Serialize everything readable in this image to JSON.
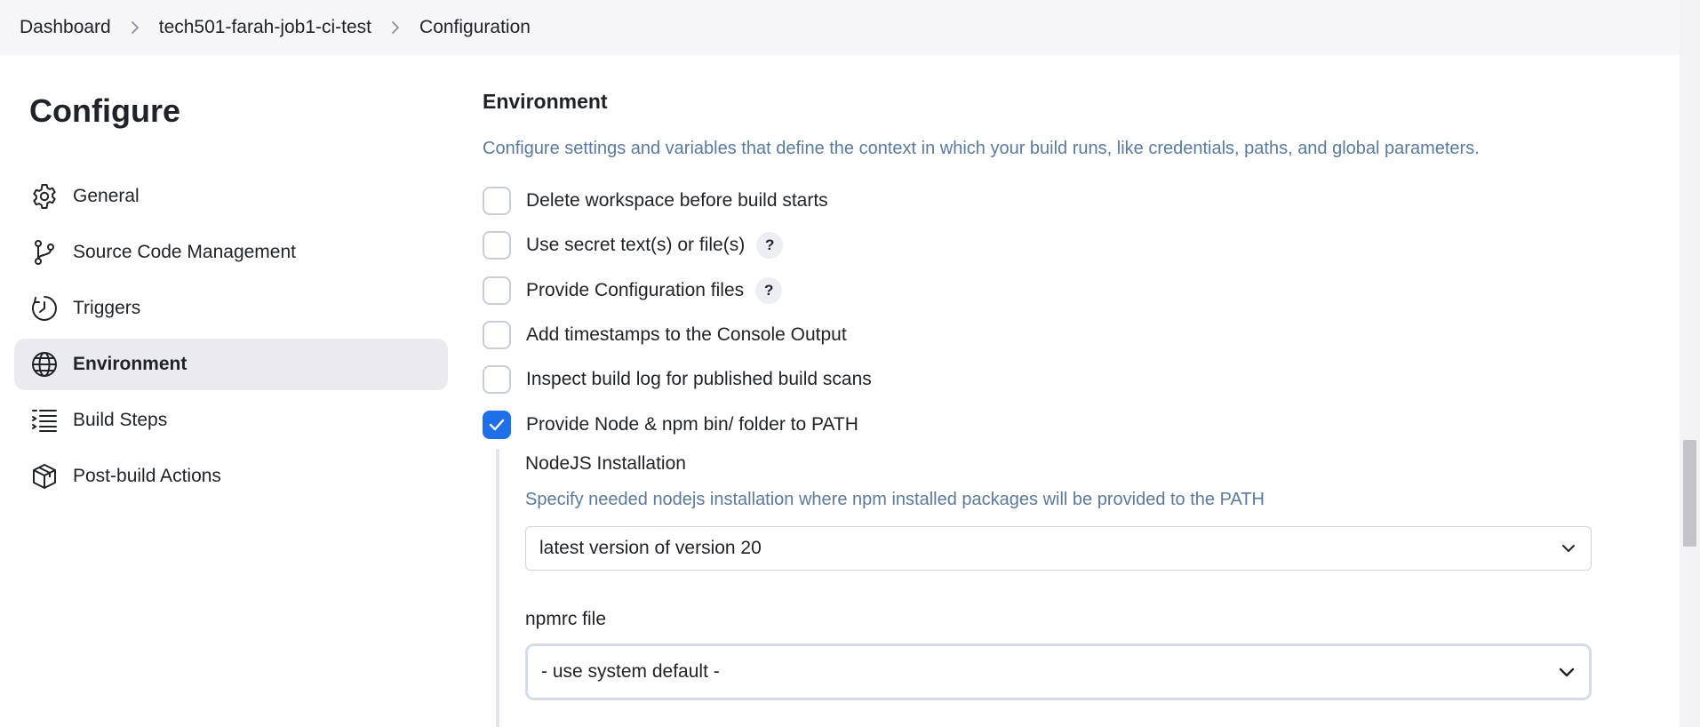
{
  "breadcrumb": {
    "items": [
      "Dashboard",
      "tech501-farah-job1-ci-test",
      "Configuration"
    ]
  },
  "sidebar": {
    "title": "Configure",
    "items": [
      {
        "label": "General",
        "icon": "gear-icon"
      },
      {
        "label": "Source Code Management",
        "icon": "git-branch-icon"
      },
      {
        "label": "Triggers",
        "icon": "clock-icon"
      },
      {
        "label": "Environment",
        "icon": "globe-icon",
        "active": true
      },
      {
        "label": "Build Steps",
        "icon": "list-steps-icon"
      },
      {
        "label": "Post-build Actions",
        "icon": "package-icon"
      }
    ]
  },
  "environment": {
    "title": "Environment",
    "description": "Configure settings and variables that define the context in which your build runs, like credentials, paths, and global parameters.",
    "options": [
      {
        "label": "Delete workspace before build starts",
        "checked": false,
        "help": ""
      },
      {
        "label": "Use secret text(s) or file(s)",
        "checked": false,
        "help": "?"
      },
      {
        "label": "Provide Configuration files",
        "checked": false,
        "help": "?"
      },
      {
        "label": "Add timestamps to the Console Output",
        "checked": false,
        "help": ""
      },
      {
        "label": "Inspect build log for published build scans",
        "checked": false,
        "help": ""
      },
      {
        "label": "Provide Node & npm bin/ folder to PATH",
        "checked": true,
        "help": ""
      }
    ],
    "nodejs": {
      "label": "NodeJS Installation",
      "description": "Specify needed nodejs installation where npm installed packages will be provided to the PATH",
      "selected": "latest version of version 20"
    },
    "npmrc": {
      "label": "npmrc file",
      "selected": "- use system default -"
    }
  },
  "colors": {
    "accent": "#1f6feb",
    "muted_text": "#5b7a9c",
    "active_nav_bg": "#ebebef"
  }
}
